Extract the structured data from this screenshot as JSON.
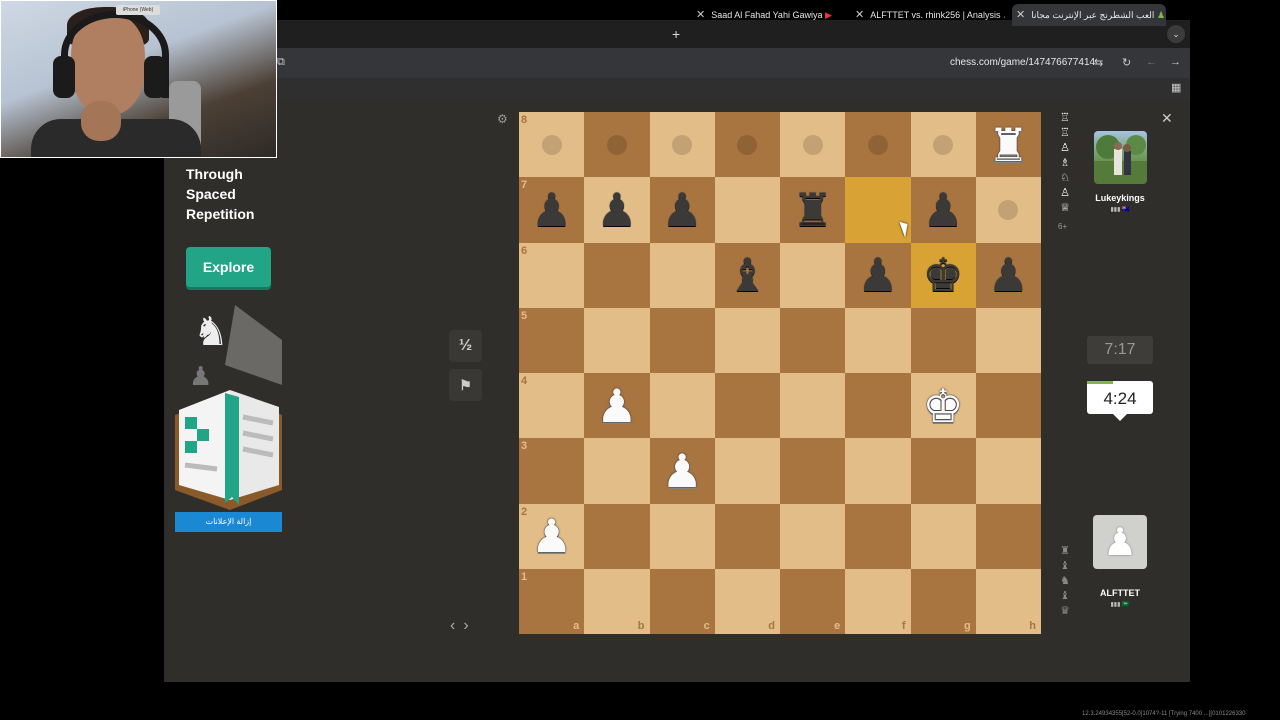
{
  "browser": {
    "tabs": [
      {
        "label": "Saad Al Fahad Yahi Gawiya"
      },
      {
        "label": "ALFTTET vs. rhink256 | Analysis"
      },
      {
        "label": "العب الشطرنج عبر الإنترنت مجانا"
      }
    ],
    "new_tab": "+",
    "url": "chess.com/game/147476677414"
  },
  "webcam": {
    "badge": "iPhone (Web)"
  },
  "ad": {
    "headline": "Through Spaced Repetition",
    "explore_label": "Explore",
    "remove_ads_label": "إزالة الإعلانات"
  },
  "controls": {
    "draw_label": "½",
    "resign_icon": "flag-icon",
    "settings_icon": "gear-icon"
  },
  "board": {
    "ranks": [
      "8",
      "7",
      "6",
      "5",
      "4",
      "3",
      "2",
      "1"
    ],
    "files": [
      "a",
      "b",
      "c",
      "d",
      "e",
      "f",
      "g",
      "h"
    ],
    "highlight_squares": [
      "f7",
      "g6"
    ],
    "move_hints": [
      "a8",
      "b8",
      "c8",
      "d8",
      "e8",
      "f8",
      "g8",
      "h7"
    ],
    "pieces": [
      {
        "sq": "h8",
        "glyph": "♜",
        "color": "white"
      },
      {
        "sq": "a7",
        "glyph": "♟",
        "color": "black"
      },
      {
        "sq": "b7",
        "glyph": "♟",
        "color": "black"
      },
      {
        "sq": "c7",
        "glyph": "♟",
        "color": "black"
      },
      {
        "sq": "e7",
        "glyph": "♜",
        "color": "black"
      },
      {
        "sq": "g7",
        "glyph": "♟",
        "color": "black"
      },
      {
        "sq": "d6",
        "glyph": "♝",
        "color": "black"
      },
      {
        "sq": "f6",
        "glyph": "♟",
        "color": "black"
      },
      {
        "sq": "g6",
        "glyph": "♚",
        "color": "black"
      },
      {
        "sq": "h6",
        "glyph": "♟",
        "color": "black"
      },
      {
        "sq": "b4",
        "glyph": "♟",
        "color": "white"
      },
      {
        "sq": "g4",
        "glyph": "♚",
        "color": "white"
      },
      {
        "sq": "c3",
        "glyph": "♟",
        "color": "white"
      },
      {
        "sq": "a2",
        "glyph": "♟",
        "color": "white"
      }
    ]
  },
  "opponent": {
    "name": "Lukeykings",
    "clock": "7:17",
    "captured": [
      "♖",
      "♖",
      "♙",
      "♗",
      "♘",
      "♙",
      "♕"
    ],
    "material": "6+"
  },
  "player": {
    "name": "ALFTTET",
    "clock": "4:24",
    "captured": [
      "♜",
      "♝",
      "♞",
      "♝",
      "♛"
    ]
  },
  "navigation": {
    "prev": "‹",
    "next": "›"
  },
  "footer_text": "12.3.24934355[52-0.0]1074?-11 [Trying 7400 ...][0101226330"
}
